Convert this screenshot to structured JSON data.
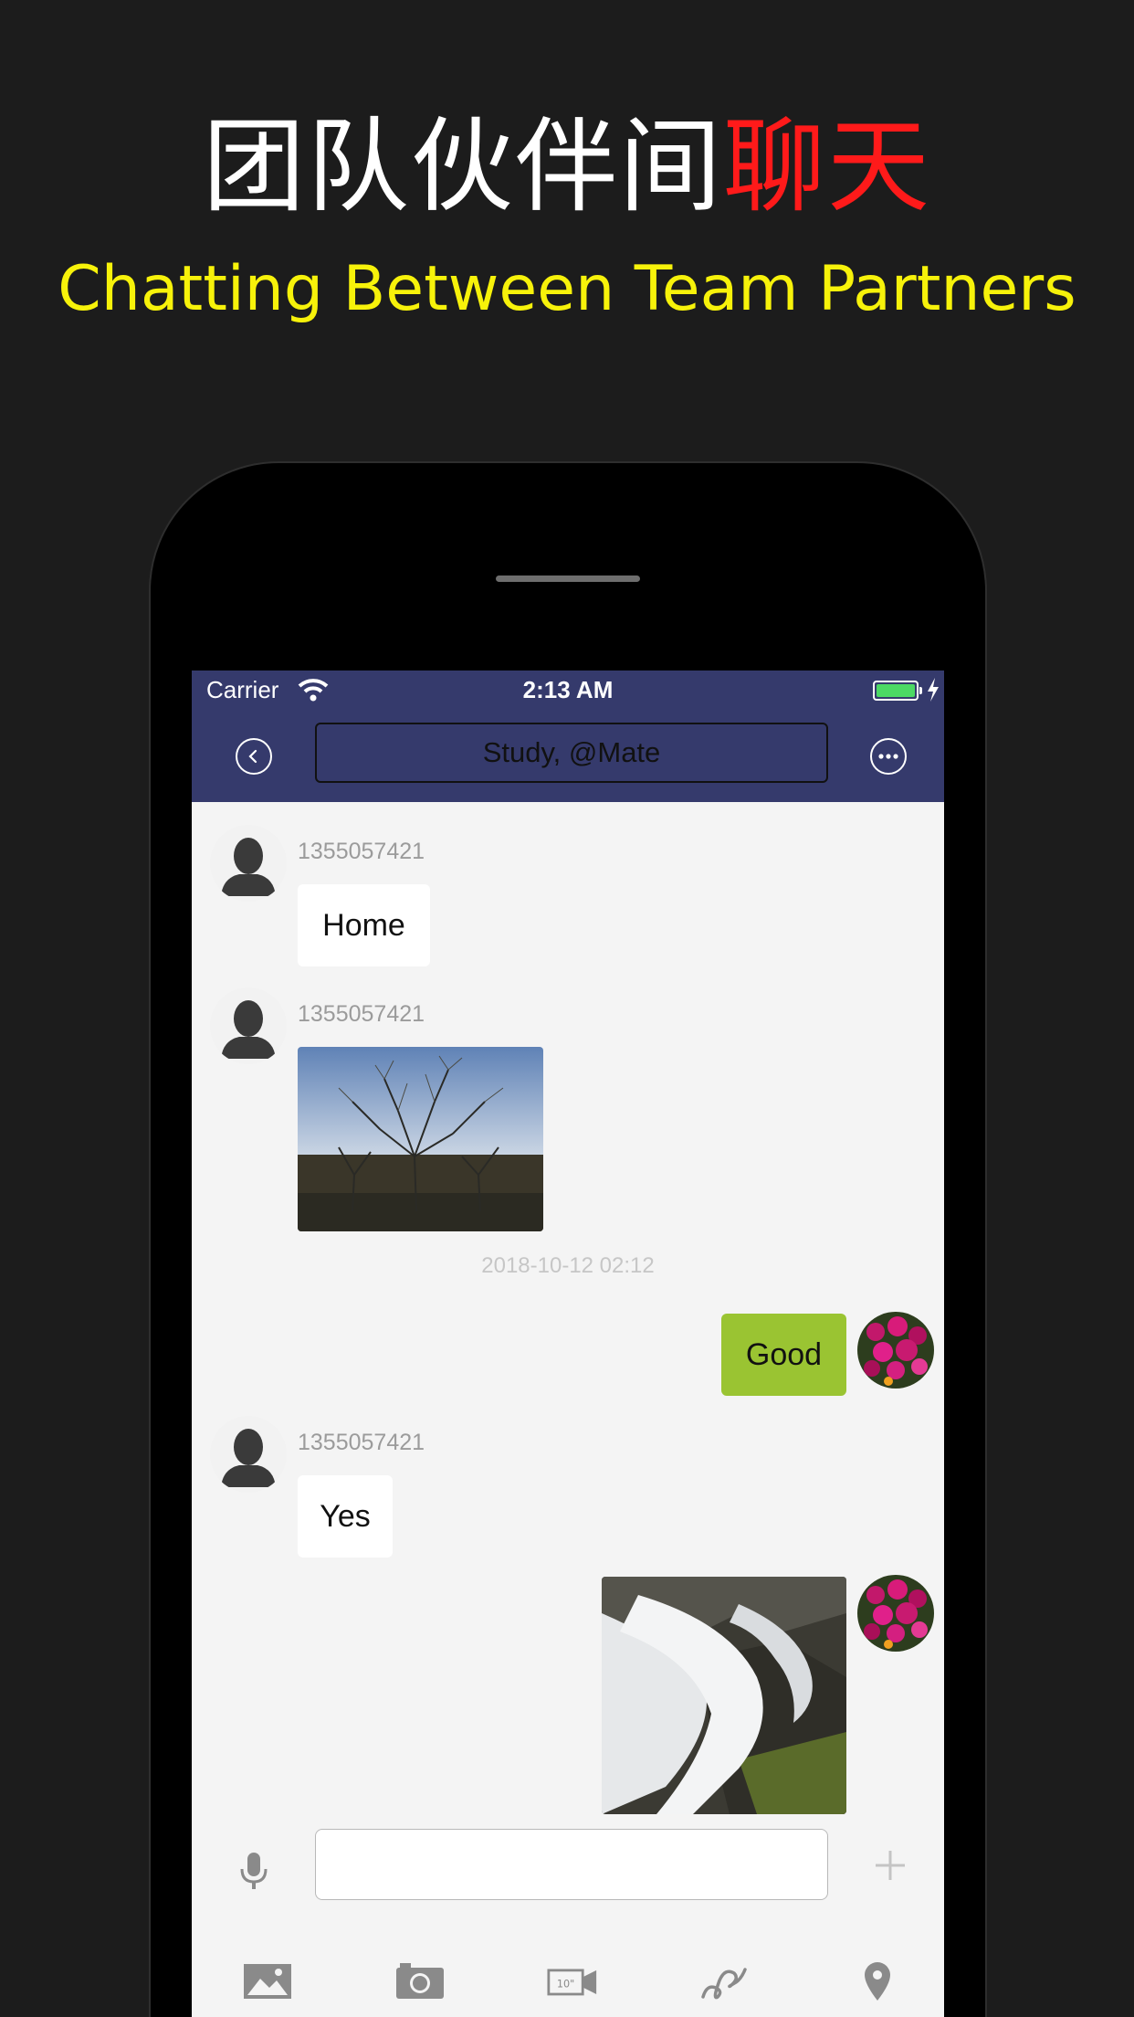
{
  "hero": {
    "title_cn_main": "团队伙伴间",
    "title_cn_accent": "聊天",
    "title_en": "Chatting Between Team Partners"
  },
  "status_bar": {
    "carrier": "Carrier",
    "time": "2:13 AM"
  },
  "nav": {
    "title": "Study, @Mate"
  },
  "messages": [
    {
      "sender": "1355057421",
      "text": "Home"
    },
    {
      "sender": "1355057421",
      "image": "tree-photo"
    },
    {
      "timestamp": "2018-10-12 02:12"
    },
    {
      "mine": true,
      "text": "Good"
    },
    {
      "sender": "1355057421",
      "text": "Yes"
    },
    {
      "mine": true,
      "image": "waterfall-photo"
    }
  ],
  "input": {
    "value": ""
  },
  "toolbar": [
    "image-icon",
    "camera-icon",
    "video-icon",
    "scribble-icon",
    "location-pin-icon"
  ],
  "colors": {
    "background": "#1c1c1c",
    "accent_red": "#ff1a1a",
    "title_yellow": "#f7f20a",
    "nav_bar": "#353a6c",
    "my_bubble": "#9ac432",
    "battery": "#4cd964"
  }
}
